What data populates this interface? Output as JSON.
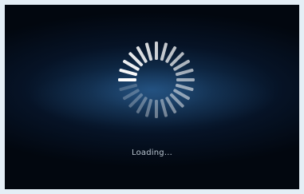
{
  "screen": {
    "status_text": "Loading...",
    "icon": "loading-spinner-icon",
    "colors": {
      "background_center": "#1e4a77",
      "background_edge": "#02070f",
      "frame_border": "#e4eef6",
      "spinner": "#ffffff",
      "text": "#b9c4cf"
    }
  }
}
